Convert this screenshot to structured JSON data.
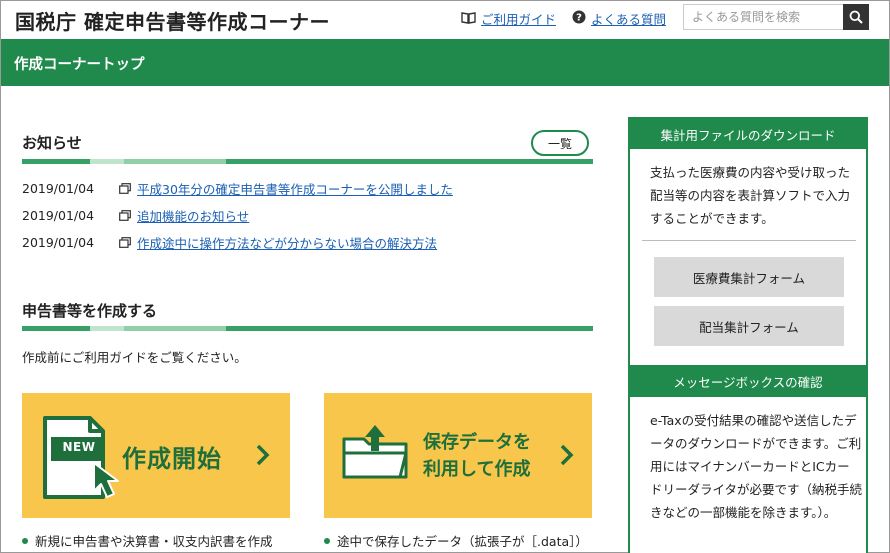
{
  "header": {
    "site_title": "国税庁 確定申告書等作成コーナー",
    "guide_link": "ご利用ガイド",
    "faq_link": "よくある質問",
    "search_placeholder": "よくある質問を検索"
  },
  "topbar": {
    "title": "作成コーナートップ"
  },
  "news": {
    "title": "お知らせ",
    "list_button": "一覧",
    "items": [
      {
        "date": "2019/01/04",
        "text": "平成30年分の確定申告書等作成コーナーを公開しました"
      },
      {
        "date": "2019/01/04",
        "text": "追加機能のお知らせ"
      },
      {
        "date": "2019/01/04",
        "text": "作成途中に操作方法などが分からない場合の解決方法"
      }
    ]
  },
  "create": {
    "title": "申告書等を作成する",
    "intro": "作成前にご利用ガイドをご覧ください。",
    "card_new": {
      "badge": "NEW",
      "label": "作成開始"
    },
    "card_saved": {
      "line1": "保存データを",
      "line2": "利用して作成"
    },
    "bullet_new": "新規に申告書や決算書・収支内訳書を作成",
    "bullet_saved": "途中で保存したデータ（拡張子が［.data］）"
  },
  "sidebar": {
    "download_title": "集計用ファイルのダウンロード",
    "download_text": "支払った医療費の内容や受け取った配当等の内容を表計算ソフトで入力することができます。",
    "medical_button": "医療費集計フォーム",
    "dividend_button": "配当集計フォーム",
    "message_title": "メッセージボックスの確認",
    "message_text": "e-Taxの受付結果の確認や送信したデータのダウンロードができます。ご利用にはマイナンバーカードとICカードリーダライタが必要です（納税手続きなどの一部機能を除きます。）。"
  },
  "colors": {
    "green": "#1f8a4c",
    "card_yellow": "#f7c64b",
    "link_blue": "#1a5fb4"
  }
}
